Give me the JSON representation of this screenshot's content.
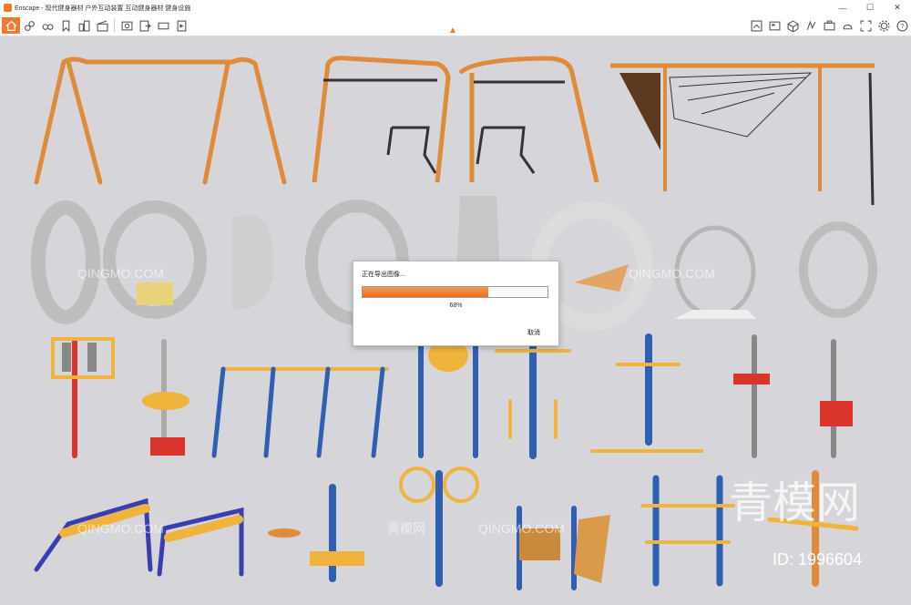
{
  "window": {
    "title": "Enscape - 现代健身器材 户外互动装置 互动健身器材 健身设施",
    "buttons": {
      "minimize": "—",
      "maximize": "☐",
      "close": "✕"
    }
  },
  "toolbar": {
    "icons": [
      "home-icon",
      "settings-link-icon",
      "binoculars-icon",
      "bookmark-icon",
      "city-icon",
      "clapboard-icon",
      "screenshot-icon",
      "export-icon",
      "layers-icon",
      "video-export-icon",
      "panorama-icon",
      "render-preview-icon",
      "asset-library-icon",
      "materials-icon",
      "capture-icon",
      "sky-icon",
      "fullscreen-icon",
      "gear-icon",
      "help-icon"
    ]
  },
  "export_dialog": {
    "title": "正在导出图像...",
    "progress": 0.68,
    "percent_label": "68%",
    "cancel_label": "取消"
  },
  "watermark": {
    "text": "QINGMO.COM",
    "cn": "青模网",
    "id": "ID: 1996604"
  },
  "colors": {
    "accent": "#ef7a2b",
    "blue": "#2f5fb3",
    "yellow": "#f0b43c",
    "red": "#d9352b",
    "orange": "#e08b3a"
  }
}
